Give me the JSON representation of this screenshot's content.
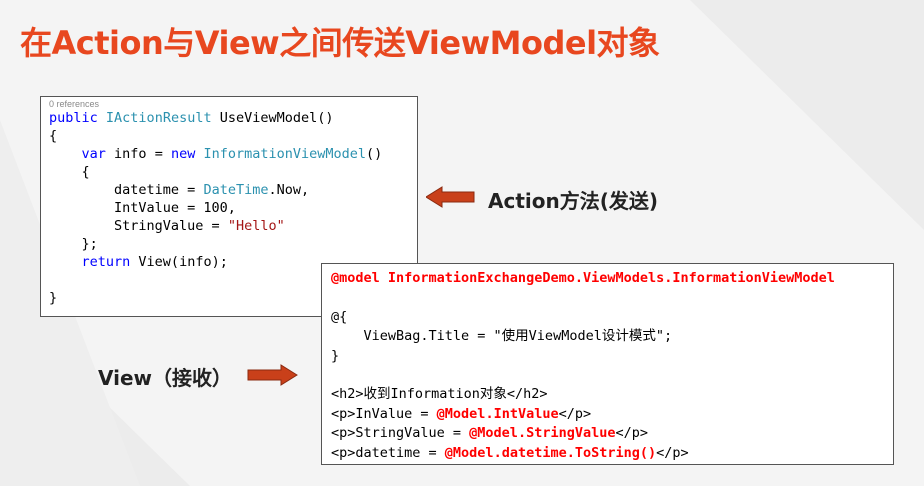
{
  "slide": {
    "title": "在Action与View之间传送ViewModel对象"
  },
  "action_code": {
    "references": "0 references",
    "lines": [
      "public IActionResult UseViewModel()",
      "{",
      "    var info = new InformationViewModel()",
      "    {",
      "        datetime = DateTime.Now,",
      "        IntValue = 100,",
      "        StringValue = \"Hello\"",
      "    };",
      "    return View(info);",
      "",
      "}"
    ]
  },
  "view_code": {
    "lines": [
      "@model InformationExchangeDemo.ViewModels.InformationViewModel",
      "",
      "@{",
      "    ViewBag.Title = \"使用ViewModel设计模式\";",
      "}",
      "",
      "<h2>收到Information对象</h2>",
      "<p>InValue = @Model.IntValue</p>",
      "<p>StringValue = @Model.StringValue</p>",
      "<p>datetime = @Model.datetime.ToString()</p>"
    ]
  },
  "labels": {
    "action": "Action方法(发送)",
    "view": "View（接收）"
  },
  "colors": {
    "title": "#e8471f",
    "arrow": "#c9401a",
    "keyword": "#0000ff",
    "type": "#2b91af",
    "string": "#a31515",
    "razor": "#ff0000"
  }
}
